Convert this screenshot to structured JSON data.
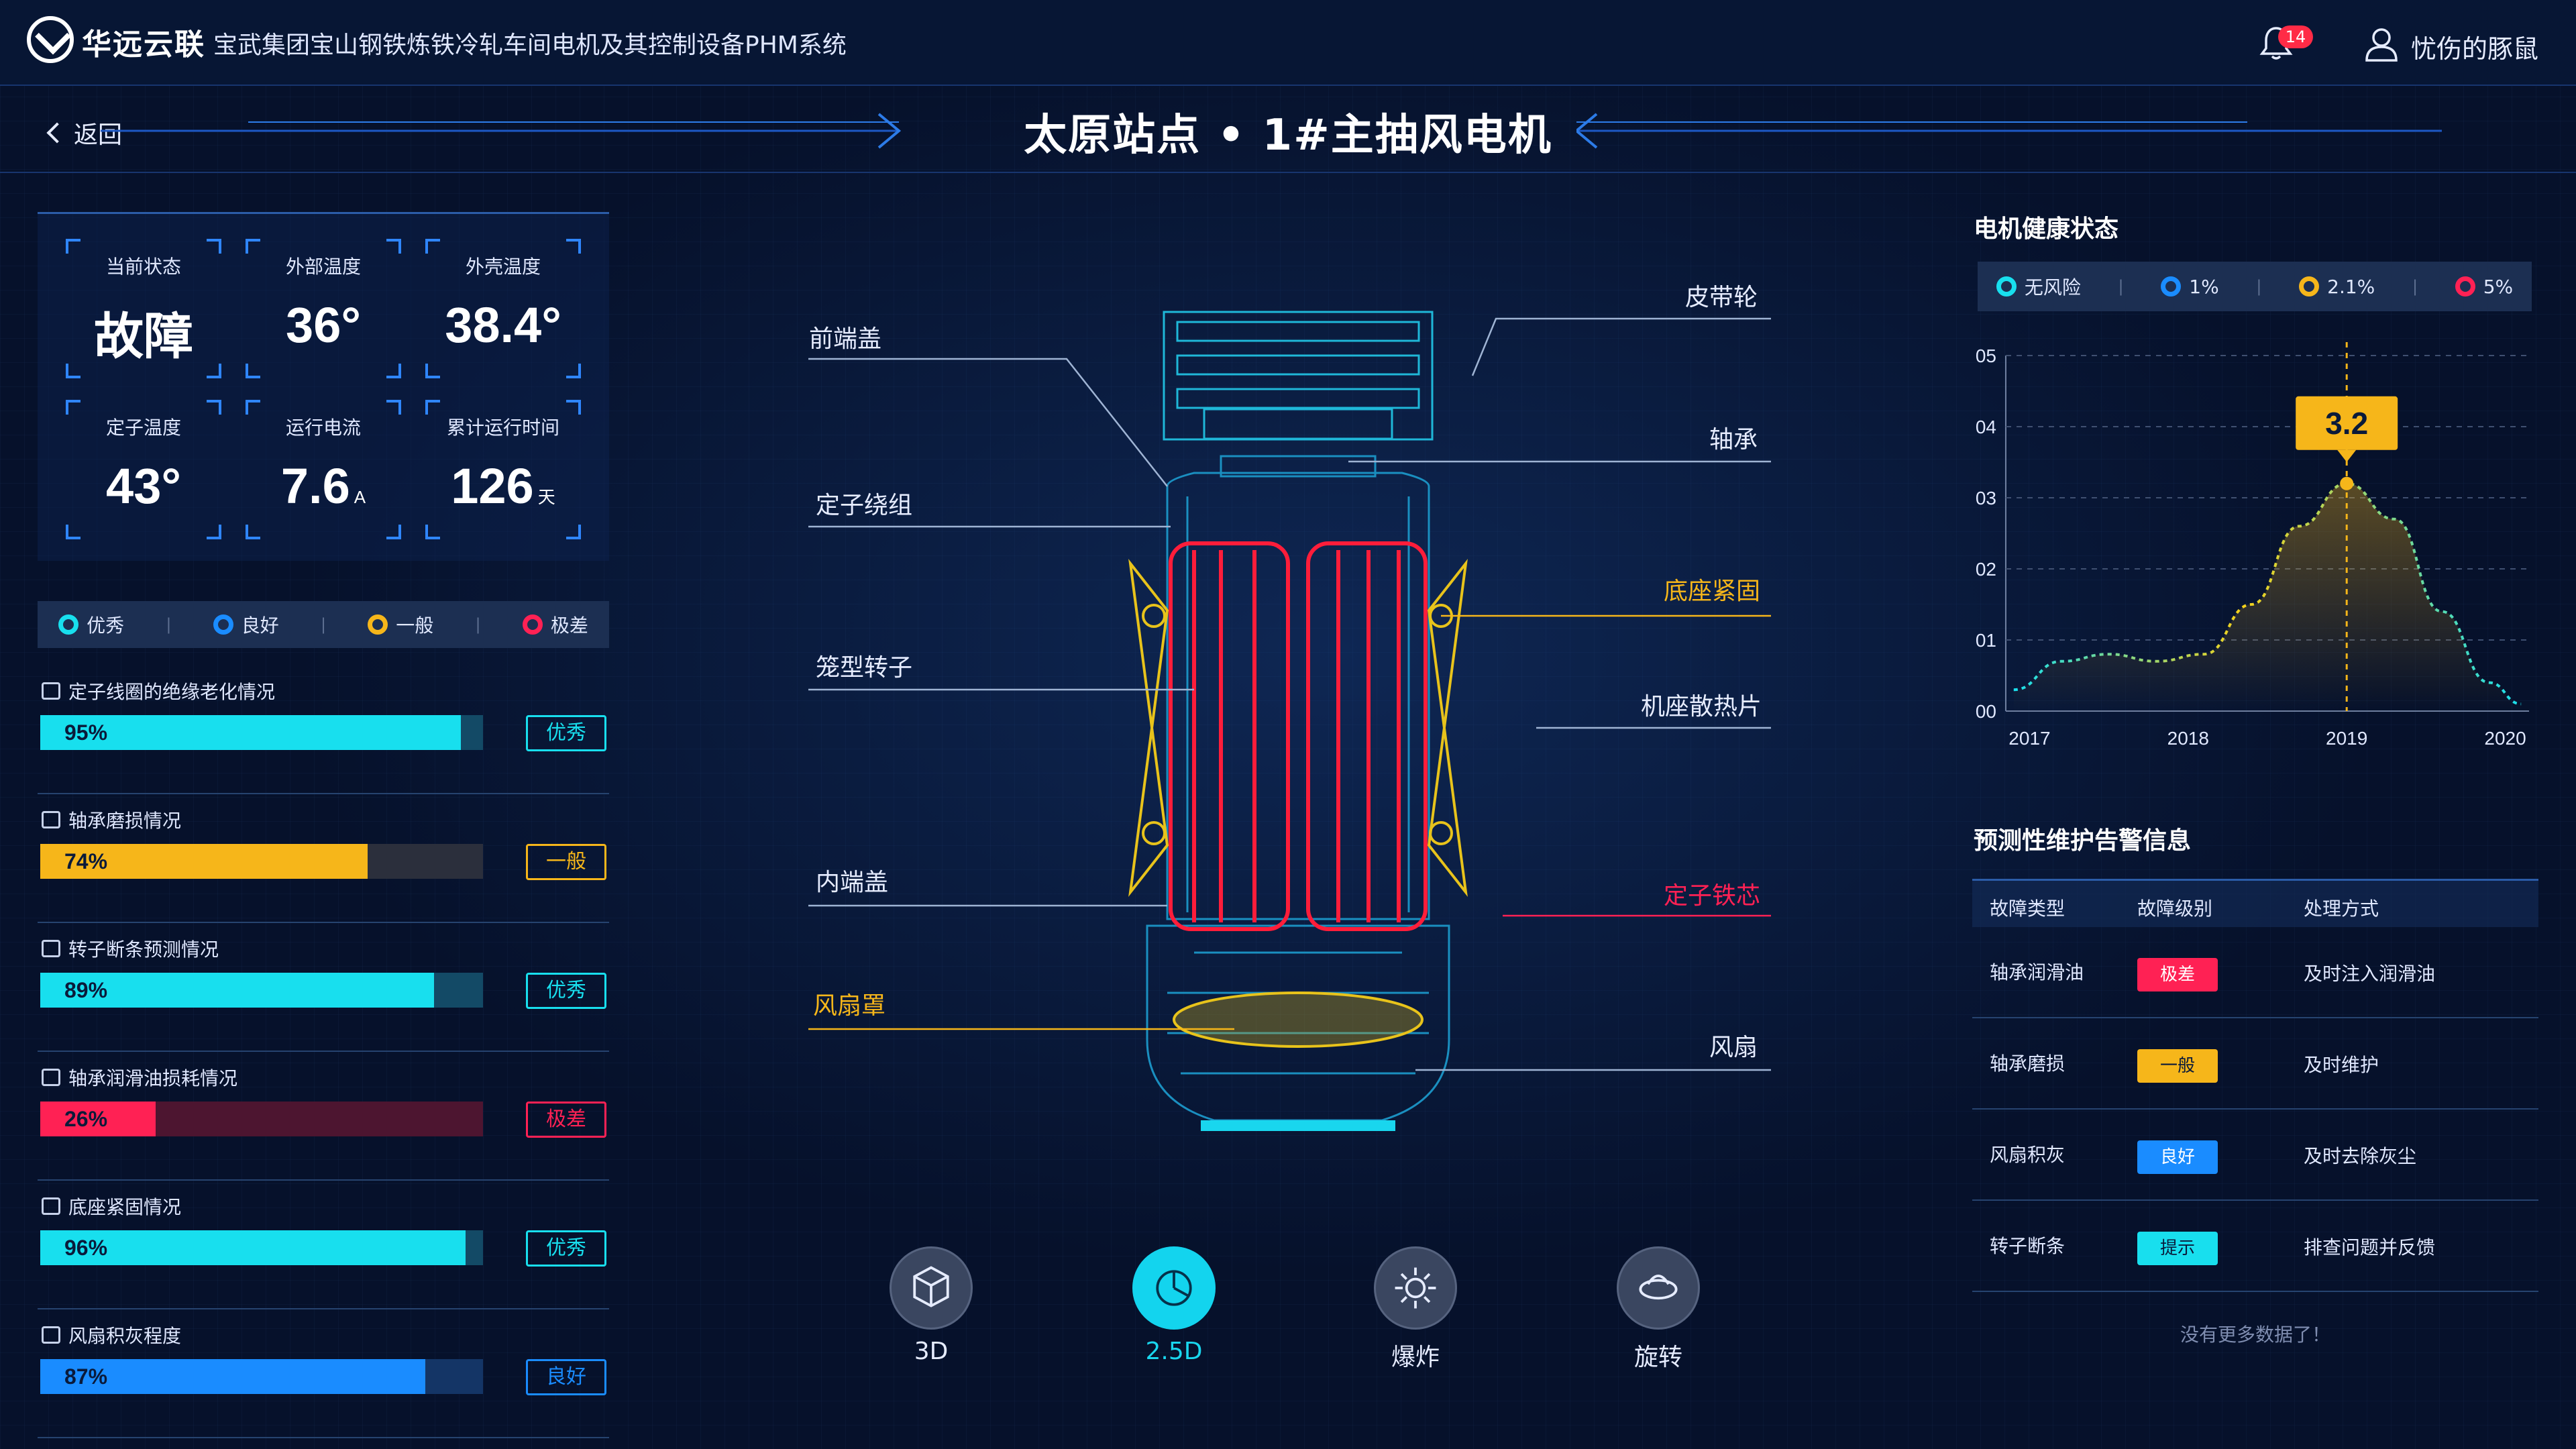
{
  "header": {
    "brand": "华远云联",
    "system_title": "宝武集团宝山钢铁炼铁冷轧车间电机及其控制设备PHM系统",
    "notification_count": "14",
    "user_name": "忧伤的豚鼠"
  },
  "subheader": {
    "back_label": "返回",
    "title": "太原站点 • 1#主抽风电机"
  },
  "stats": [
    {
      "label": "当前状态",
      "value": "故障",
      "unit": ""
    },
    {
      "label": "外部温度",
      "value": "36°",
      "unit": ""
    },
    {
      "label": "外壳温度",
      "value": "38.4°",
      "unit": ""
    },
    {
      "label": "定子温度",
      "value": "43°",
      "unit": ""
    },
    {
      "label": "运行电流",
      "value": "7.6",
      "unit": "A"
    },
    {
      "label": "累计运行时间",
      "value": "126",
      "unit": "天"
    }
  ],
  "grade_legend": [
    {
      "label": "优秀",
      "color": "#18dfee"
    },
    {
      "label": "良好",
      "color": "#1a8cff"
    },
    {
      "label": "一般",
      "color": "#f6b61a"
    },
    {
      "label": "极差",
      "color": "#ff2154"
    }
  ],
  "metrics": [
    {
      "label": "定子线圈的绝缘老化情况",
      "icon": "pencil-icon",
      "percent": "95%",
      "fraction": 0.95,
      "grade": "优秀",
      "color": "#18dfee",
      "track": "#134a66"
    },
    {
      "label": "轴承磨损情况",
      "icon": "gear-icon",
      "percent": "74%",
      "fraction": 0.74,
      "grade": "一般",
      "color": "#f6b61a",
      "track": "#2b2f3c"
    },
    {
      "label": "转子断条预测情况",
      "icon": "rotor-icon",
      "percent": "89%",
      "fraction": 0.89,
      "grade": "优秀",
      "color": "#18dfee",
      "track": "#134a66"
    },
    {
      "label": "轴承润滑油损耗情况",
      "icon": "oil-icon",
      "percent": "26%",
      "fraction": 0.26,
      "grade": "极差",
      "color": "#ff2154",
      "track": "#4d1530"
    },
    {
      "label": "底座紧固情况",
      "icon": "base-icon",
      "percent": "96%",
      "fraction": 0.96,
      "grade": "优秀",
      "color": "#18dfee",
      "track": "#134a66"
    },
    {
      "label": "风扇积灰程度",
      "icon": "fan-icon",
      "percent": "87%",
      "fraction": 0.87,
      "grade": "良好",
      "color": "#1a8cff",
      "track": "#143566"
    }
  ],
  "motor_callouts": {
    "front_cover": "前端盖",
    "belt_pulley": "皮带轮",
    "bearing": "轴承",
    "stator_winding": "定子绕组",
    "base_fastening": "底座紧固",
    "cage_rotor": "笼型转子",
    "frame_heatsink": "机座散热片",
    "inner_cover": "内端盖",
    "stator_core": "定子铁芯",
    "fan_cover": "风扇罩",
    "fan": "风扇"
  },
  "view_modes": [
    {
      "label": "3D",
      "icon": "cube-icon",
      "active": false
    },
    {
      "label": "2.5D",
      "icon": "pie-icon",
      "active": true
    },
    {
      "label": "爆炸",
      "icon": "explode-icon",
      "active": false
    },
    {
      "label": "旋转",
      "icon": "rotate-icon",
      "active": false
    }
  ],
  "health": {
    "title": "电机健康状态",
    "legend": [
      {
        "label": "无风险",
        "color": "#18dfee"
      },
      {
        "label": "1%",
        "color": "#1a8cff"
      },
      {
        "label": "2.1%",
        "color": "#f6b61a"
      },
      {
        "label": "5%",
        "color": "#ff2154"
      }
    ],
    "peak_label": "3.2"
  },
  "chart_data": {
    "type": "line",
    "x_ticks": [
      "2017",
      "2018",
      "2019",
      "2020"
    ],
    "y_ticks": [
      "05",
      "04",
      "03",
      "02",
      "01",
      "00"
    ],
    "ylim": [
      0,
      5
    ],
    "series": [
      {
        "x": [
          2016.9,
          2017.2,
          2017.5,
          2017.8,
          2018.1,
          2018.4,
          2018.7,
          2019.0,
          2019.3,
          2019.6,
          2019.9,
          2020.1
        ],
        "y": [
          0.3,
          0.7,
          0.8,
          0.7,
          0.8,
          1.5,
          2.6,
          3.2,
          2.7,
          1.4,
          0.4,
          0.1
        ]
      }
    ],
    "highlight": {
      "x": 2019.0,
      "y": 3.2
    },
    "grid": true
  },
  "alerts": {
    "title": "预测性维护告警信息",
    "headers": [
      "故障类型",
      "故障级别",
      "处理方式"
    ],
    "rows": [
      {
        "type": "轴承润滑油",
        "level": "极差",
        "level_color": "#ff2154",
        "action": "及时注入润滑油"
      },
      {
        "type": "轴承磨损",
        "level": "一般",
        "level_color": "#f6b61a",
        "action": "及时维护"
      },
      {
        "type": "风扇积灰",
        "level": "良好",
        "level_color": "#1a8cff",
        "action": "及时去除灰尘"
      },
      {
        "type": "转子断条",
        "level": "提示",
        "level_color": "#18dfee",
        "action": "排查问题并反馈"
      }
    ],
    "no_more": "没有更多数据了！"
  }
}
